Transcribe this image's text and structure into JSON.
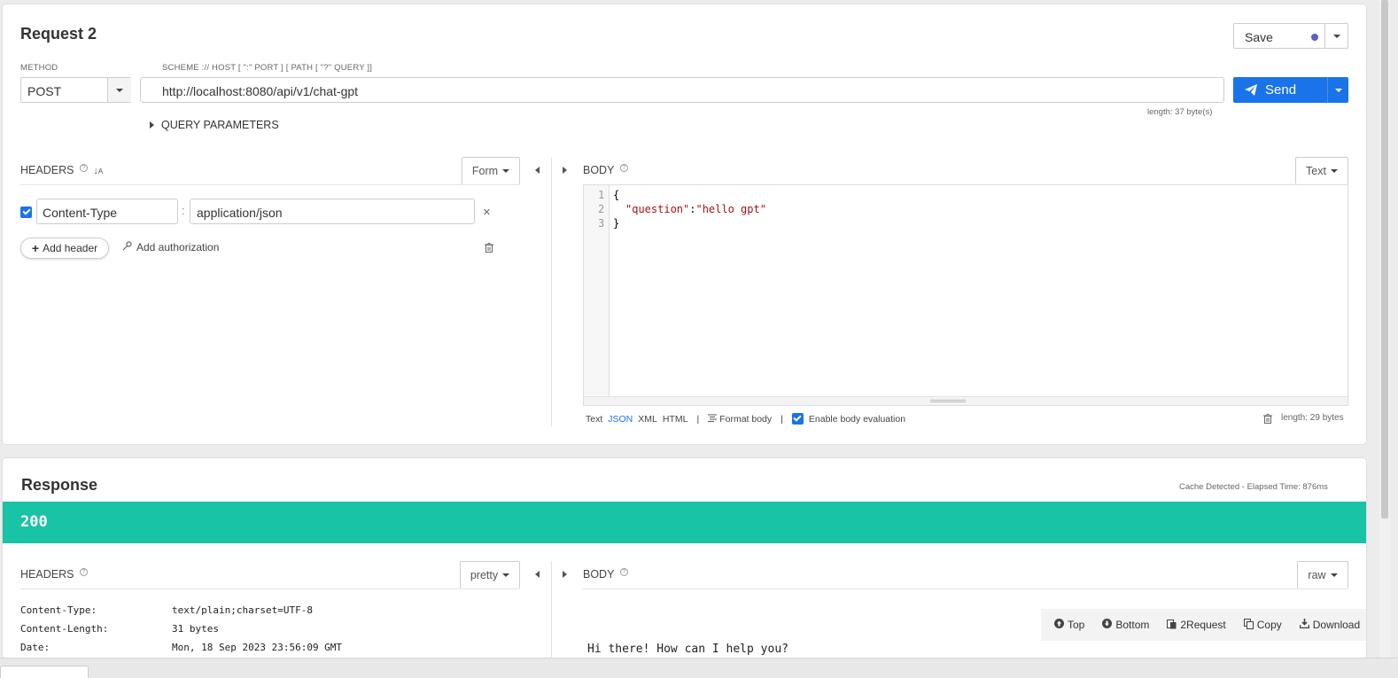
{
  "request": {
    "title": "Request 2",
    "save_label": "Save",
    "method_label": "METHOD",
    "method_value": "POST",
    "scheme_label": "SCHEME :// HOST [ \":\" PORT ] [ PATH [ \"?\" QUERY ]]",
    "url_value": "http://localhost:8080/api/v1/chat-gpt",
    "send_label": "Send",
    "length_note": "length: 37 byte(s)",
    "query_params_label": "QUERY PARAMETERS",
    "headers_label": "HEADERS",
    "headers_mode": "Form",
    "header_rows": [
      {
        "name": "Content-Type",
        "value": "application/json",
        "sep": ":",
        "remove": "×"
      }
    ],
    "add_header_label": "Add header",
    "add_auth_label": "Add authorization",
    "body_label": "BODY",
    "body_mode": "Text",
    "body_lines": [
      {
        "num": "1",
        "text": "{"
      },
      {
        "num": "2",
        "key": "\"question\"",
        "colon": ":",
        "value": "\"hello gpt\""
      },
      {
        "num": "3",
        "text": "}"
      }
    ],
    "body_formats": [
      "Text",
      "JSON",
      "XML",
      "HTML"
    ],
    "format_sep": "|",
    "format_body_label": "Format body",
    "enable_eval_label": "Enable body evaluation",
    "body_length": "length: 29 bytes"
  },
  "response": {
    "title": "Response",
    "cache_note": "Cache Detected - Elapsed Time: 876ms",
    "status_code": "200",
    "headers_label": "HEADERS",
    "headers_mode": "pretty",
    "body_label": "BODY",
    "body_mode": "raw",
    "header_rows": [
      {
        "name": "Content-Type:",
        "value": "text/plain;charset=UTF-8"
      },
      {
        "name": "Content-Length:",
        "value": "31 bytes"
      },
      {
        "name": "Date:",
        "value": "Mon, 18 Sep 2023 23:56:09 GMT"
      }
    ],
    "body_text": "Hi there! How can I help you?",
    "toolbar": {
      "top": "Top",
      "bottom": "Bottom",
      "to_request": "2Request",
      "copy": "Copy",
      "download": "Download"
    }
  },
  "colors": {
    "accent": "#1a73e8",
    "status_ok": "#19c3a6",
    "save_dot": "#5b5fc7",
    "json_key": "#a11",
    "json_string": "#a11"
  }
}
